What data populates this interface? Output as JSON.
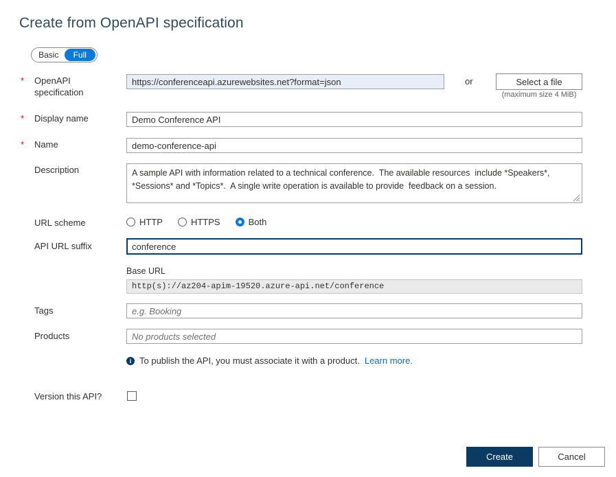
{
  "page": {
    "title": "Create from OpenAPI specification"
  },
  "mode_toggle": {
    "basic_label": "Basic",
    "full_label": "Full",
    "selected": "Full",
    "active_color": "#0f7ad4"
  },
  "fields": {
    "spec": {
      "label_line1": "OpenAPI",
      "label_line2": "specification",
      "required_marker": "*",
      "value": "https://conferenceapi.azurewebsites.net?format=json",
      "or_text": "or",
      "select_file_label": "Select a file",
      "max_size_note": "(maximum size 4 MiB)"
    },
    "display_name": {
      "label": "Display name",
      "required_marker": "*",
      "value": "Demo Conference API"
    },
    "name": {
      "label": "Name",
      "required_marker": "*",
      "value": "demo-conference-api"
    },
    "description": {
      "label": "Description",
      "value": "A sample API with information related to a technical conference.  The available resources  include *Speakers*, *Sessions* and *Topics*.  A single write operation is available to provide  feedback on a session."
    },
    "url_scheme": {
      "label": "URL scheme",
      "options": [
        "HTTP",
        "HTTPS",
        "Both"
      ],
      "selected": "Both"
    },
    "api_url_suffix": {
      "label": "API URL suffix",
      "value": "conference",
      "focused": true
    },
    "base_url": {
      "label": "Base URL",
      "value": "http(s)://az204-apim-19520.azure-api.net/conference"
    },
    "tags": {
      "label": "Tags",
      "value": "",
      "placeholder": "e.g. Booking"
    },
    "products": {
      "label": "Products",
      "value": "",
      "placeholder": "No products selected"
    },
    "version_api": {
      "label": "Version this API?",
      "checked": false
    }
  },
  "notice": {
    "icon": "info-icon",
    "text": "To publish the API, you must associate it with a product.",
    "link_label": "Learn more.",
    "link_color": "#0f6cbd"
  },
  "footer": {
    "create_label": "Create",
    "cancel_label": "Cancel",
    "create_color": "#0b3b63"
  }
}
